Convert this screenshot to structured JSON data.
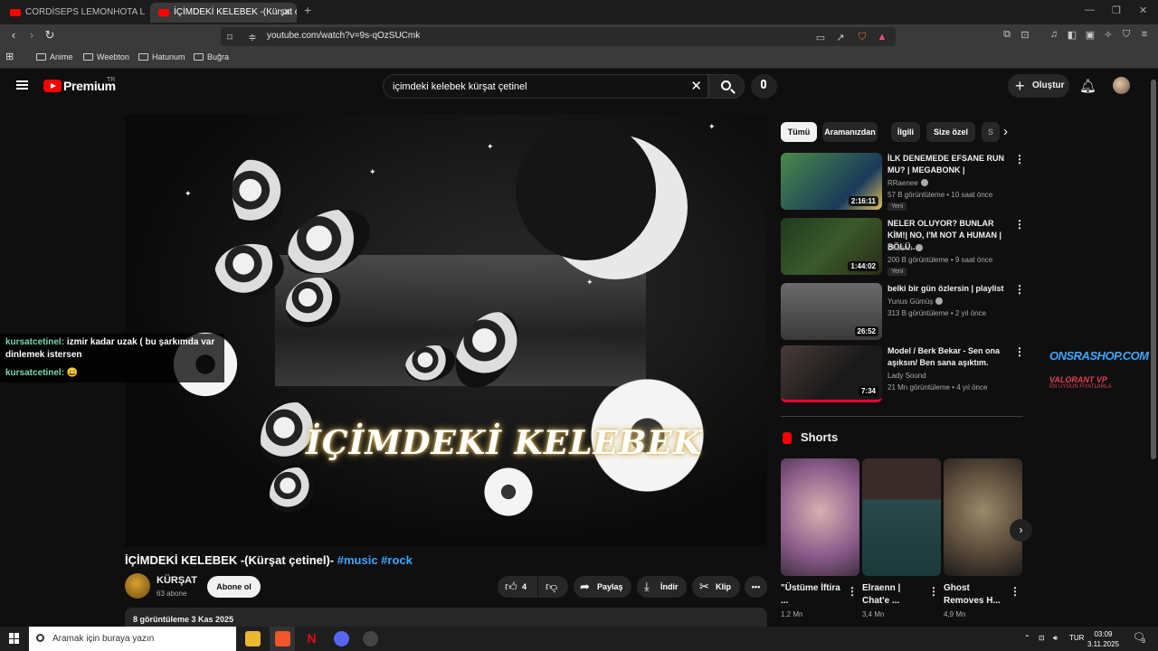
{
  "browser": {
    "tabs": [
      {
        "label": "CORDİSEPS LEMONHOTA LİMON TA",
        "active": false
      },
      {
        "label": "İÇİMDEKİ KELEBEK -(Kürşat ç",
        "active": true
      }
    ],
    "url": "youtube.com/watch?v=9s-qOzSUCmk",
    "bookmarks": [
      "Anime",
      "Weebton",
      "Hatunum",
      "Buğra"
    ]
  },
  "youtube": {
    "logo_text": "Premium",
    "logo_region": "TR",
    "search_value": "içimdeki kelebek kürşat çetinel",
    "create_label": "Oluştur"
  },
  "video": {
    "overlay_title": "İÇİMDEKİ KELEBEK",
    "title": "İÇİMDEKİ KELEBEK -(Kürşat çetinel)-",
    "hashtags": "#music #rock",
    "channel": "KÜRŞAT",
    "subscribers": "63 abone",
    "subscribe_label": "Abone ol",
    "likes": "4",
    "share_label": "Paylaş",
    "download_label": "İndir",
    "clip_label": "Klip",
    "views": "8 görüntüleme",
    "date": "3 Kas 2025"
  },
  "chat": [
    {
      "name": "kursatcetinel:",
      "message": "izmir kadar uzak ( bu şarkımda var dinlemek istersen"
    },
    {
      "name": "kursatcetinel:",
      "message": "😄"
    }
  ],
  "chips": [
    "Tümü",
    "Aramanızdan",
    "İlgili",
    "Size özel",
    "S"
  ],
  "recommendations": [
    {
      "title": "İLK DENEMEDE EFSANE RUN MU? | MEGABONK |",
      "channel": "RRaenee",
      "views": "57 B görüntüleme",
      "age": "10 saat önce",
      "duration": "2:16:11",
      "badge": "Yeni",
      "thumb_color": "#2f6f3a"
    },
    {
      "title": "NELER OLUYOR? BUNLAR KİM!| NO, I'M NOT A HUMAN | BÖLÜ...",
      "channel": "Elraenn",
      "views": "200 B görüntüleme",
      "age": "9 saat önce",
      "duration": "1:44:02",
      "badge": "Yeni",
      "thumb_color": "#2c4a2a"
    },
    {
      "title": "belki bir gün özlersin | playlist",
      "channel": "Yunus Gümüş",
      "views": "313 B görüntüleme",
      "age": "2 yıl önce",
      "duration": "26:52",
      "badge": "",
      "thumb_color": "#5a5a5a"
    },
    {
      "title": "Model / Berk Bekar - Sen ona aşıksın/  Ben sana aşıktım.",
      "channel": "Lady Sound",
      "views": "21 Mn görüntüleme",
      "age": "4 yıl önce",
      "duration": "7:34",
      "badge": "",
      "thumb_color": "#3a2a2a"
    }
  ],
  "shorts": {
    "header": "Shorts",
    "items": [
      {
        "title": "\"Üstüme İftira ...",
        "views": "1,2 Mn",
        "thumb_color": "#a07a8a"
      },
      {
        "title": "Elraenn | Chat'e ...",
        "views": "3,4 Mn",
        "thumb_color": "#2d4a3a"
      },
      {
        "title": "Ghost Removes H...",
        "views": "4,9 Mn",
        "thumb_color": "#7a6a52"
      }
    ]
  },
  "ad": {
    "brand": "ONSRASHOP.COM",
    "line": "VALORANT VP",
    "sub": "EN UYGUN FİYATLARLA"
  },
  "taskbar": {
    "search_placeholder": "Aramak için buraya yazın",
    "lang": "TUR",
    "time": "03:09",
    "date": "3.11.2025",
    "notifications": "3"
  }
}
